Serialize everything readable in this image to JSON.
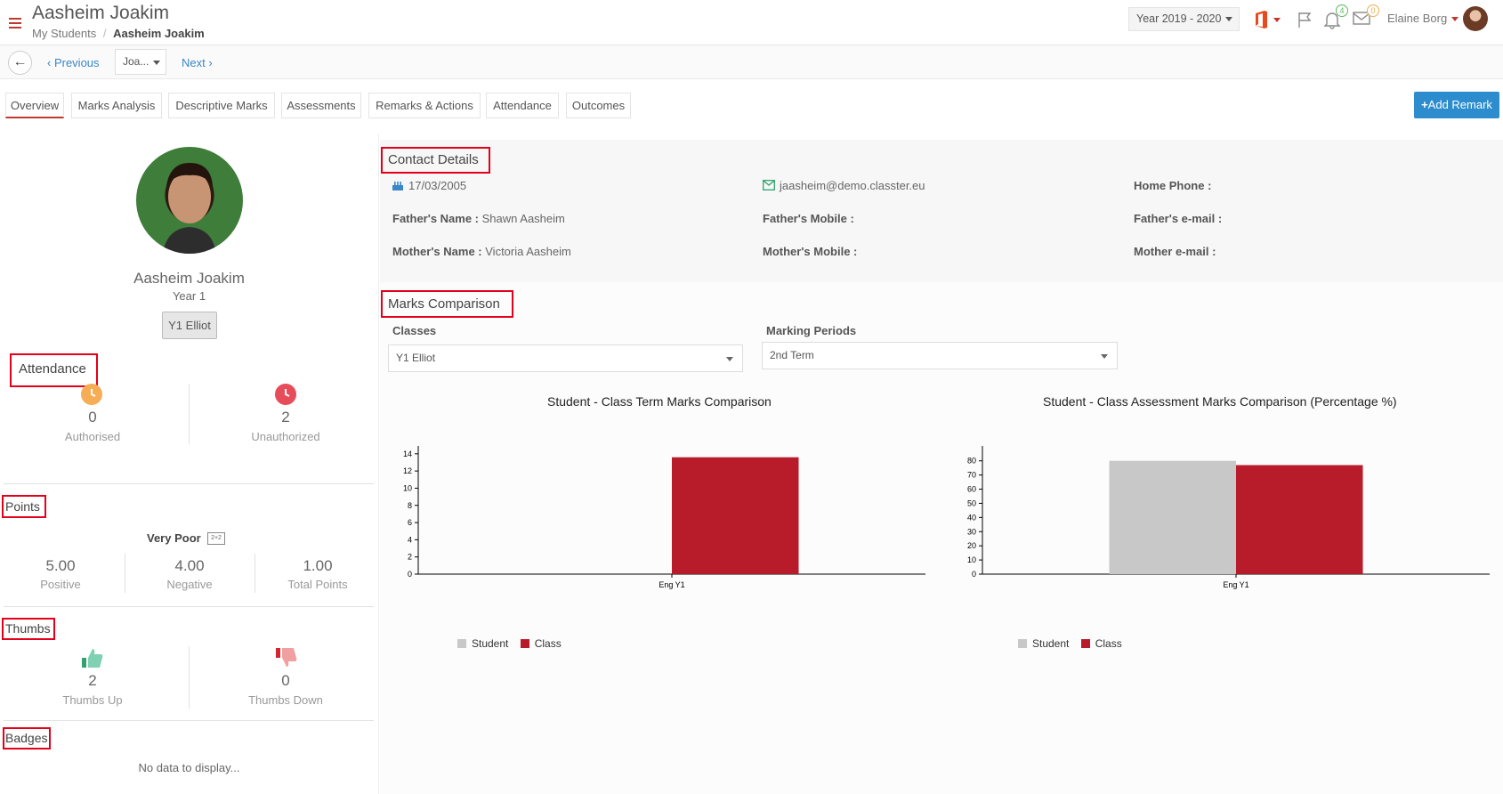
{
  "header": {
    "title": "Aasheim Joakim",
    "breadcrumb_root": "My Students",
    "breadcrumb_current": "Aasheim Joakim",
    "year_select": "Year 2019 - 2020",
    "notifications_count": "4",
    "messages_count": "0",
    "user_name": "Elaine Borg"
  },
  "subnav": {
    "previous": "Previous",
    "student_select": "Joa...",
    "next": "Next"
  },
  "tabs": [
    {
      "label": "Overview"
    },
    {
      "label": "Marks Analysis"
    },
    {
      "label": "Descriptive Marks"
    },
    {
      "label": "Assessments"
    },
    {
      "label": "Remarks & Actions"
    },
    {
      "label": "Attendance"
    },
    {
      "label": "Outcomes"
    }
  ],
  "add_remark": "Add Remark",
  "profile": {
    "name": "Aasheim Joakim",
    "year": "Year 1",
    "class": "Y1 Elliot"
  },
  "attendance": {
    "title": "Attendance",
    "authorised_count": "0",
    "authorised_label": "Authorised",
    "unauthorized_count": "2",
    "unauthorized_label": "Unauthorized"
  },
  "points": {
    "title": "Points",
    "rating": "Very Poor",
    "positive_value": "5.00",
    "positive_label": "Positive",
    "negative_value": "4.00",
    "negative_label": "Negative",
    "total_value": "1.00",
    "total_label": "Total Points"
  },
  "thumbs": {
    "title": "Thumbs",
    "up_count": "2",
    "up_label": "Thumbs Up",
    "down_count": "0",
    "down_label": "Thumbs Down"
  },
  "badges": {
    "title": "Badges",
    "empty_text": "No data to display..."
  },
  "contact": {
    "title": "Contact Details",
    "dob": "17/03/2005",
    "email": "jaasheim@demo.classter.eu",
    "home_phone_label": "Home Phone :",
    "fathers_name_label": "Father's Name :",
    "fathers_name": "Shawn Aasheim",
    "fathers_mobile_label": "Father's Mobile :",
    "fathers_email_label": "Father's e-mail :",
    "mothers_name_label": "Mother's Name :",
    "mothers_name": "Victoria Aasheim",
    "mothers_mobile_label": "Mother's Mobile :",
    "mothers_email_label": "Mother e-mail :"
  },
  "marks_comparison": {
    "title": "Marks Comparison",
    "classes_label": "Classes",
    "classes_value": "Y1 Elliot",
    "periods_label": "Marking Periods",
    "periods_value": "2nd Term"
  },
  "colors": {
    "accent_red": "#c0392b",
    "student_bar": "#c8c8c8",
    "class_bar": "#b81c2a",
    "primary_button": "#2d8ccd"
  },
  "chart_data": [
    {
      "type": "bar",
      "title": "Student - Class Term Marks Comparison",
      "categories": [
        "Eng Y1"
      ],
      "series": [
        {
          "name": "Student",
          "values": [
            0
          ]
        },
        {
          "name": "Class",
          "values": [
            13.6
          ]
        }
      ],
      "yticks": [
        0,
        2,
        4,
        6,
        8,
        10,
        12,
        14
      ],
      "ylim": [
        0,
        14.5
      ],
      "legend": "bottom-left"
    },
    {
      "type": "bar",
      "title": "Student - Class Assessment Marks Comparison (Percentage %)",
      "categories": [
        "Eng Y1"
      ],
      "series": [
        {
          "name": "Student",
          "values": [
            80
          ]
        },
        {
          "name": "Class",
          "values": [
            77
          ]
        }
      ],
      "yticks": [
        0,
        10,
        20,
        30,
        40,
        50,
        60,
        70,
        80
      ],
      "ylim": [
        0,
        88
      ],
      "legend": "bottom-left"
    }
  ]
}
